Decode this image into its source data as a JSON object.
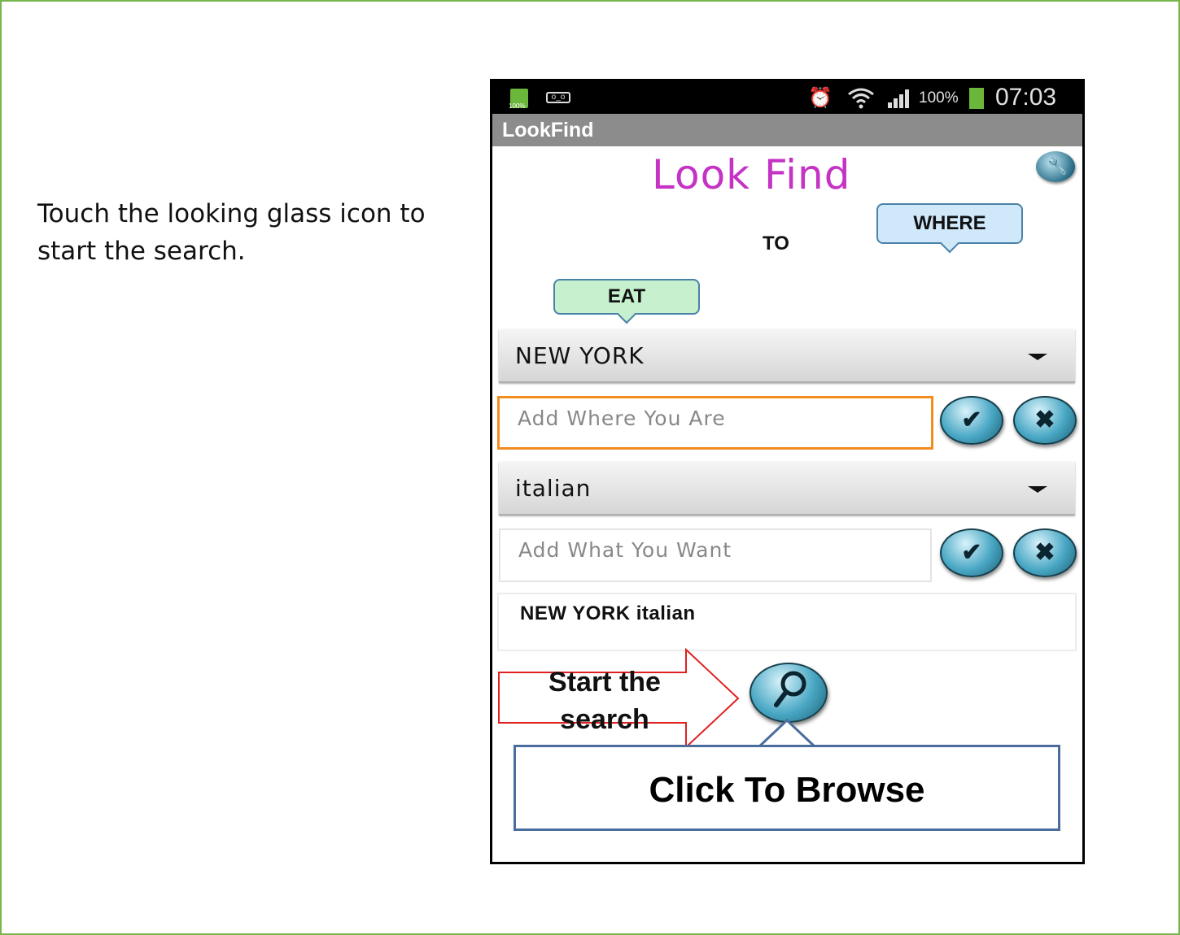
{
  "instruction": {
    "line1": "Touch the looking glass icon to",
    "line2": "start the search."
  },
  "statusbar": {
    "battery_small": "100%",
    "voicemail_icon": "voicemail-icon",
    "alarm_icon": "alarm-icon",
    "wifi_icon": "wifi-icon",
    "signal_icon": "signal-icon",
    "battery_percent": "100%",
    "time": "07:03"
  },
  "app": {
    "title": "LookFind",
    "logo": "Look Find",
    "info_icon": "info-icon"
  },
  "bubbles": {
    "where": "WHERE",
    "to": "TO",
    "eat": "EAT"
  },
  "city_dropdown": {
    "selected": "NEW YORK"
  },
  "where_input": {
    "placeholder": "Add Where You Are",
    "value": ""
  },
  "food_dropdown": {
    "selected": "italian"
  },
  "what_input": {
    "placeholder": "Add What You Want",
    "value": ""
  },
  "buttons": {
    "ok_symbol": "✔",
    "cancel_symbol": "✖"
  },
  "summary": {
    "text": "NEW YORK  italian"
  },
  "arrow_callout": {
    "line1": "Start the",
    "line2": "search"
  },
  "browse_callout": {
    "text": "Click To Browse"
  },
  "colors": {
    "slide_border": "#77b64a",
    "logo": "#c433c4",
    "focused_input": "#f28c1e",
    "callout_border": "#4a6d9d",
    "arrow_outline": "#e02020"
  }
}
